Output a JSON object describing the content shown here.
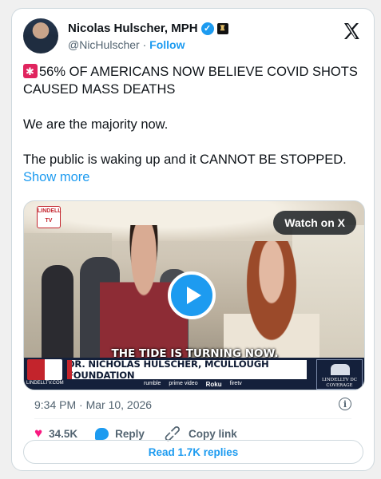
{
  "author": {
    "name": "Nicolas Hulscher, MPH",
    "handle": "@NicHulscher",
    "separator": "·",
    "follow_label": "Follow"
  },
  "tweet": {
    "line1": "56% OF AMERICANS NOW BELIEVE COVID SHOTS CAUSED MASS DEATHS",
    "line2": "We are the majority now.",
    "line3": "The public is waking up and it CANNOT BE STOPPED.",
    "show_more": "Show more"
  },
  "media": {
    "watch_label": "Watch on X",
    "logo_text": "LINDELL TV",
    "caption": "THE TIDE IS TURNING NOW.",
    "lower_third": "DR. NICHOLAS HULSCHER, MCULLOUGH FOUNDATION",
    "site": "LINDELLTV.COM",
    "brands": [
      "rumble",
      "prime video",
      "Roku",
      "firetv"
    ],
    "dc_label": "LINDELLTV DC COVERAGE"
  },
  "timestamp": "9:34 PM · Mar 10, 2026",
  "info_icon": "i",
  "actions": {
    "likes": "34.5K",
    "reply_label": "Reply",
    "copy_label": "Copy link"
  },
  "read_replies": "Read 1.7K replies",
  "colors": {
    "accent": "#1d9bf0",
    "like": "#f91880"
  }
}
